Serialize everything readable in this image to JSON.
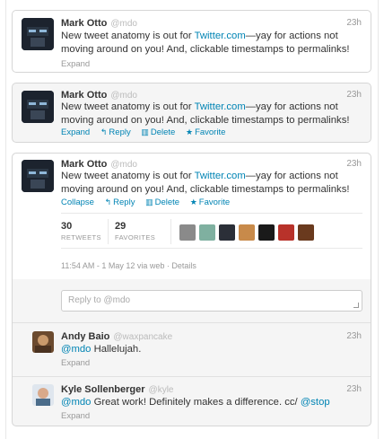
{
  "colors": {
    "link": "#0084b4",
    "muted": "#999999",
    "border": "#d6d6d6"
  },
  "tweets": [
    {
      "name": "Mark Otto",
      "handle": "@mdo",
      "time": "23h",
      "text_a": "New tweet anatomy is out for ",
      "text_link": "Twitter.com",
      "text_b": "—yay for actions not moving around on you! And, clickable timestamps to permalinks!",
      "expand": "Expand"
    },
    {
      "name": "Mark Otto",
      "handle": "@mdo",
      "time": "23h",
      "text_a": "New tweet anatomy is out for ",
      "text_link": "Twitter.com",
      "text_b": "—yay for actions not moving around on you! And, clickable timestamps to permalinks!",
      "expand": "Expand",
      "reply": "Reply",
      "delete": "Delete",
      "favorite": "Favorite"
    },
    {
      "name": "Mark Otto",
      "handle": "@mdo",
      "time": "23h",
      "text_a": "New tweet anatomy is out for ",
      "text_link": "Twitter.com",
      "text_b": "—yay for actions not moving around on you! And, clickable timestamps to permalinks!",
      "collapse": "Collapse",
      "reply": "Reply",
      "delete": "Delete",
      "favorite": "Favorite",
      "retweets_count": "30",
      "retweets_label": "RETWEETS",
      "favorites_count": "29",
      "favorites_label": "FAVORITES",
      "meta_time": "11:54 AM - 1 May 12 via web",
      "meta_details": "Details",
      "reply_placeholder": "Reply to @mdo"
    }
  ],
  "replies": [
    {
      "name": "Andy Baio",
      "handle": "@waxpancake",
      "time": "23h",
      "mention": "@mdo",
      "text": " Hallelujah.",
      "expand": "Expand"
    },
    {
      "name": "Kyle Sollenberger",
      "handle": "@kyle",
      "time": "23h",
      "mention": "@mdo",
      "text": " Great work! Definitely makes a difference. cc/ ",
      "mention2": "@stop",
      "expand": "Expand"
    }
  ]
}
